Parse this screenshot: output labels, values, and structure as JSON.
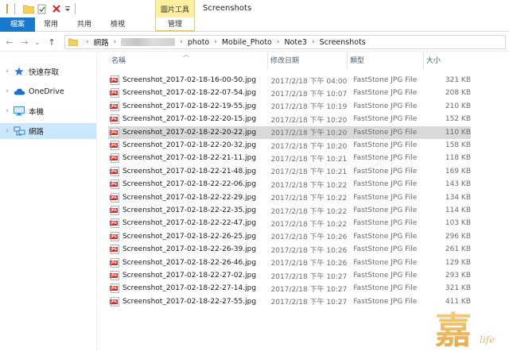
{
  "window": {
    "title": "Screenshots"
  },
  "ribbon": {
    "context_group": "圖片工具",
    "tabs": [
      {
        "label": "檔案"
      },
      {
        "label": "常用"
      },
      {
        "label": "共用"
      },
      {
        "label": "檢視"
      },
      {
        "label": "管理"
      }
    ]
  },
  "address": {
    "segments": [
      "網路",
      "photo",
      "Mobile_Photo",
      "Note3",
      "Screenshots"
    ]
  },
  "nav": {
    "items": [
      {
        "label": "快速存取",
        "icon": "star-icon"
      },
      {
        "label": "OneDrive",
        "icon": "cloud-icon"
      },
      {
        "label": "本機",
        "icon": "computer-icon"
      },
      {
        "label": "網路",
        "icon": "network-icon",
        "selected": true
      }
    ]
  },
  "columns": {
    "name": "名稱",
    "date": "修改日期",
    "type": "類型",
    "size": "大小"
  },
  "files": [
    {
      "name": "Screenshot_2017-02-18-16-00-50.jpg",
      "date": "2017/2/18 下午 04:00",
      "type": "FastStone JPG File",
      "size": "321 KB"
    },
    {
      "name": "Screenshot_2017-02-18-22-07-54.jpg",
      "date": "2017/2/18 下午 10:07",
      "type": "FastStone JPG File",
      "size": "208 KB"
    },
    {
      "name": "Screenshot_2017-02-18-22-19-55.jpg",
      "date": "2017/2/18 下午 10:19",
      "type": "FastStone JPG File",
      "size": "210 KB"
    },
    {
      "name": "Screenshot_2017-02-18-22-20-15.jpg",
      "date": "2017/2/18 下午 10:20",
      "type": "FastStone JPG File",
      "size": "152 KB"
    },
    {
      "name": "Screenshot_2017-02-18-22-20-22.jpg",
      "date": "2017/2/18 下午 10:20",
      "type": "FastStone JPG File",
      "size": "110 KB",
      "selected": true
    },
    {
      "name": "Screenshot_2017-02-18-22-20-32.jpg",
      "date": "2017/2/18 下午 10:20",
      "type": "FastStone JPG File",
      "size": "158 KB"
    },
    {
      "name": "Screenshot_2017-02-18-22-21-11.jpg",
      "date": "2017/2/18 下午 10:21",
      "type": "FastStone JPG File",
      "size": "118 KB"
    },
    {
      "name": "Screenshot_2017-02-18-22-21-48.jpg",
      "date": "2017/2/18 下午 10:21",
      "type": "FastStone JPG File",
      "size": "169 KB"
    },
    {
      "name": "Screenshot_2017-02-18-22-22-06.jpg",
      "date": "2017/2/18 下午 10:22",
      "type": "FastStone JPG File",
      "size": "143 KB"
    },
    {
      "name": "Screenshot_2017-02-18-22-22-29.jpg",
      "date": "2017/2/18 下午 10:22",
      "type": "FastStone JPG File",
      "size": "134 KB"
    },
    {
      "name": "Screenshot_2017-02-18-22-22-35.jpg",
      "date": "2017/2/18 下午 10:22",
      "type": "FastStone JPG File",
      "size": "114 KB"
    },
    {
      "name": "Screenshot_2017-02-18-22-22-47.jpg",
      "date": "2017/2/18 下午 10:22",
      "type": "FastStone JPG File",
      "size": "103 KB"
    },
    {
      "name": "Screenshot_2017-02-18-22-26-25.jpg",
      "date": "2017/2/18 下午 10:26",
      "type": "FastStone JPG File",
      "size": "296 KB"
    },
    {
      "name": "Screenshot_2017-02-18-22-26-39.jpg",
      "date": "2017/2/18 下午 10:26",
      "type": "FastStone JPG File",
      "size": "261 KB"
    },
    {
      "name": "Screenshot_2017-02-18-22-26-46.jpg",
      "date": "2017/2/18 下午 10:26",
      "type": "FastStone JPG File",
      "size": "129 KB"
    },
    {
      "name": "Screenshot_2017-02-18-22-27-02.jpg",
      "date": "2017/2/18 下午 10:27",
      "type": "FastStone JPG File",
      "size": "293 KB"
    },
    {
      "name": "Screenshot_2017-02-18-22-27-14.jpg",
      "date": "2017/2/18 下午 10:27",
      "type": "FastStone JPG File",
      "size": "321 KB"
    },
    {
      "name": "Screenshot_2017-02-18-22-27-55.jpg",
      "date": "2017/2/18 下午 10:27",
      "type": "FastStone JPG File",
      "size": "411 KB"
    }
  ],
  "file_icon_text": "JPG",
  "watermark": {
    "char": "嘉",
    "suffix": "life"
  },
  "colors": {
    "file_tab": "#1979ca",
    "context_tab": "#fbefa1",
    "nav_selected": "#cce8ff",
    "row_selected": "#d9d9d9",
    "jpg_icon": "#c9302c"
  }
}
